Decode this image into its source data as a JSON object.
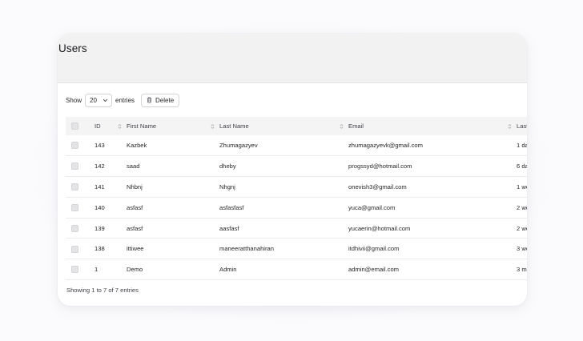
{
  "page": {
    "title": "Users"
  },
  "toolbar": {
    "show_label": "Show",
    "page_size": "20",
    "entries_label": "entries",
    "delete_label": "Delete"
  },
  "table": {
    "columns": {
      "id": "ID",
      "first_name": "First Name",
      "last_name": "Last Name",
      "email": "Email",
      "last_seen": "Last"
    },
    "rows": [
      {
        "id": "143",
        "first_name": "Kazbek",
        "last_name": "Zhumagazyev",
        "email": "zhumagazyevk@gmail.com",
        "last_seen": "1 da"
      },
      {
        "id": "142",
        "first_name": "saad",
        "last_name": "dheby",
        "email": "progssyd@hotmail.com",
        "last_seen": "6 da"
      },
      {
        "id": "141",
        "first_name": "Nhbnj",
        "last_name": "Nhgnj",
        "email": "onevish3@gmail.com",
        "last_seen": "1 we"
      },
      {
        "id": "140",
        "first_name": "asfasf",
        "last_name": "asfasfasf",
        "email": "yuca@gmail.com",
        "last_seen": "2 we"
      },
      {
        "id": "139",
        "first_name": "asfasf",
        "last_name": "aasfasf",
        "email": "yucaerin@hotmail.com",
        "last_seen": "2 we"
      },
      {
        "id": "138",
        "first_name": "ittiwee",
        "last_name": "maneeratthanahiran",
        "email": "itdhivii@gmail.com",
        "last_seen": "3 we"
      },
      {
        "id": "1",
        "first_name": "Demo",
        "last_name": "Admin",
        "email": "admin@email.com",
        "last_seen": "3 m"
      }
    ]
  },
  "footer": {
    "summary": "Showing 1 to 7 of 7 entries"
  },
  "icons": {
    "select_chevron": "chevron-down-icon",
    "delete": "trash-icon",
    "sort": "sort-icon"
  }
}
